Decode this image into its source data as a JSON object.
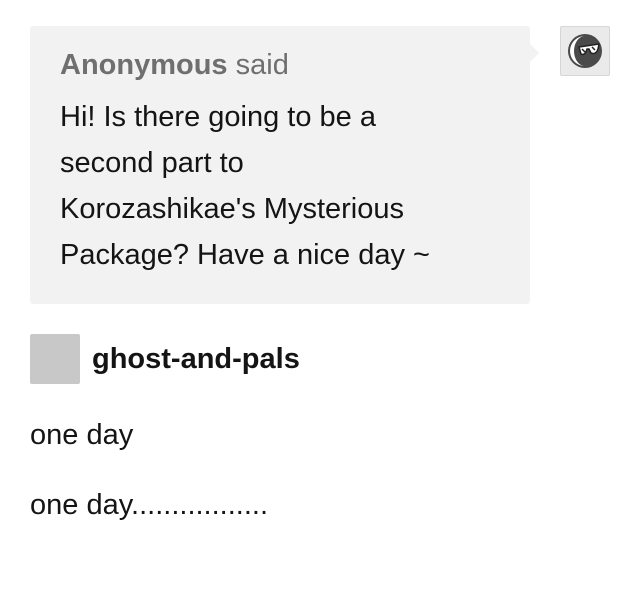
{
  "ask": {
    "asker_name": "Anonymous",
    "asker_verb": "said",
    "question": "Hi! Is there going to be a second part to Korozashikae's Mysterious Package? Have a nice day ~",
    "question_lines": [
      "Hi! Is there going to be a",
      "second part to",
      "Korozashikae's Mysterious",
      "Package? Have a nice day ~"
    ],
    "anon_avatar_icon": "anonymous-sunglasses-icon"
  },
  "answer": {
    "blog_name": "ghost-and-pals",
    "paragraphs": [
      "one day",
      "one day................."
    ]
  },
  "colors": {
    "bubble_bg": "#f2f2f2",
    "asker_text": "#6f6f6f",
    "avatar_placeholder": "#c8c8c8"
  }
}
